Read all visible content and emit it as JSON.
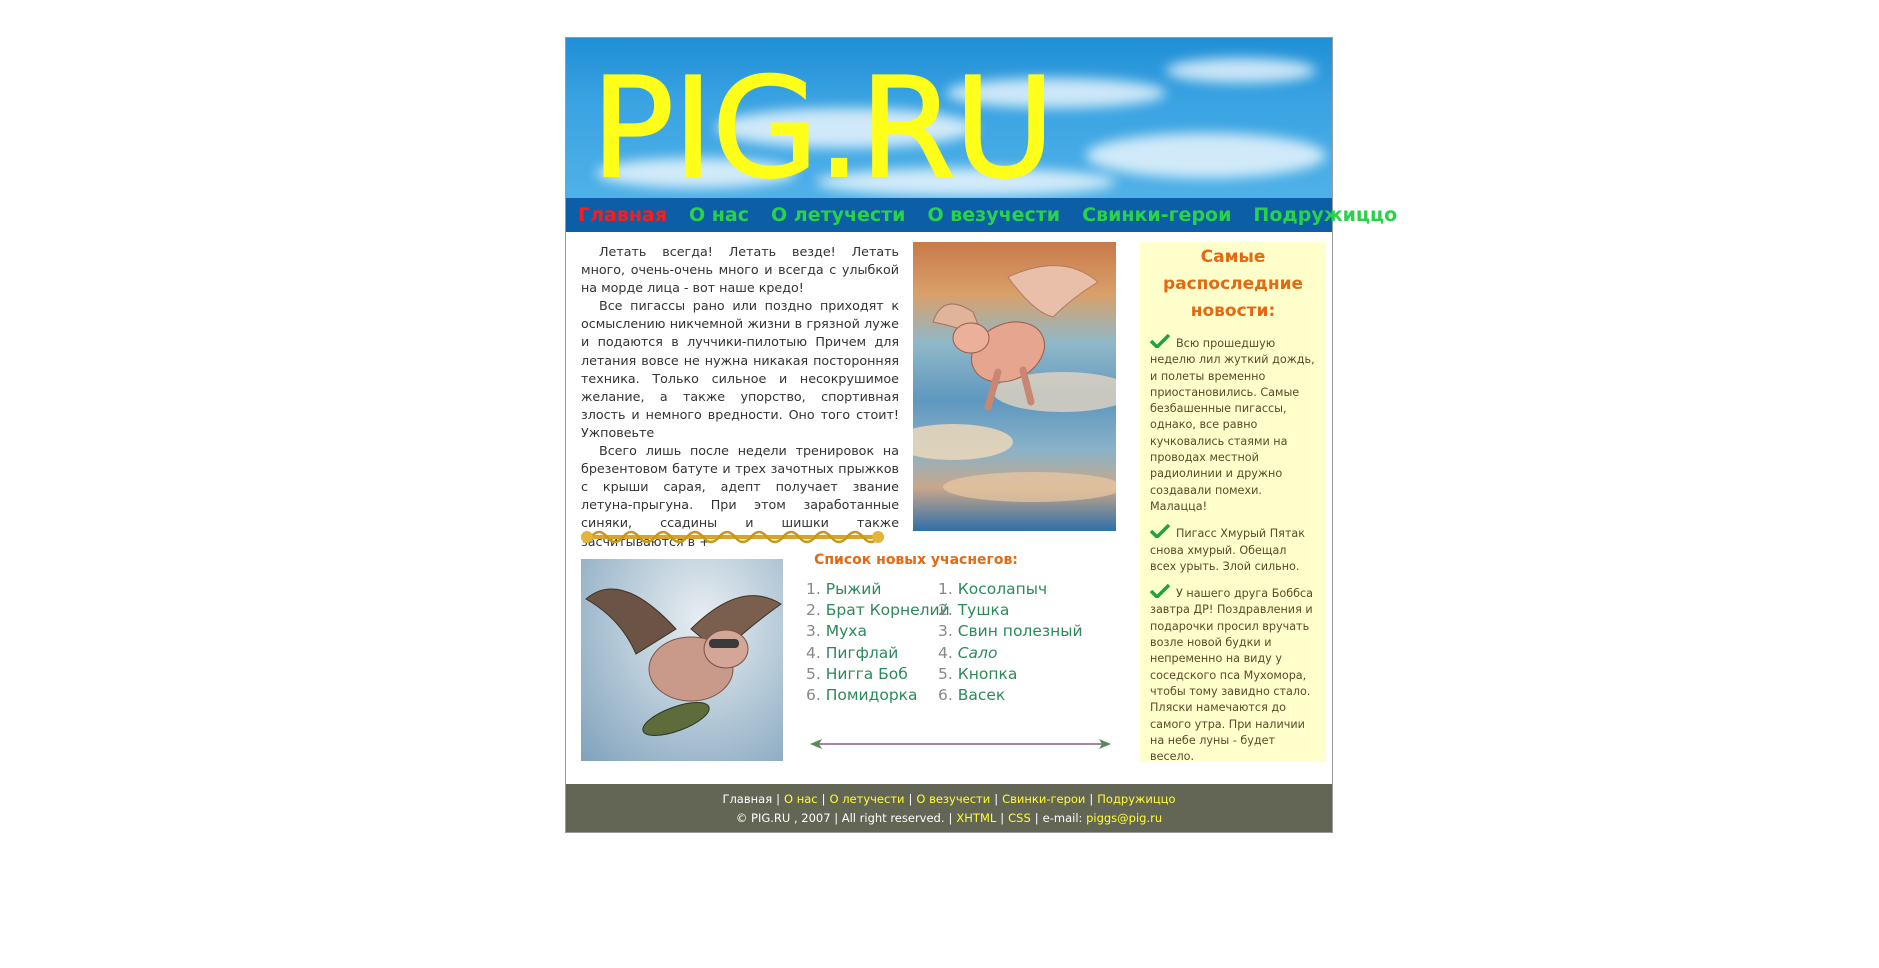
{
  "header": {
    "logo_text": "PIG.RU"
  },
  "nav": {
    "items": [
      {
        "label": "Главная",
        "active": true
      },
      {
        "label": "О нас",
        "active": false
      },
      {
        "label": "О летучести",
        "active": false
      },
      {
        "label": "О везучести",
        "active": false
      },
      {
        "label": "Свинки-герои",
        "active": false
      },
      {
        "label": "Подружиццо",
        "active": false
      }
    ]
  },
  "intro": {
    "paragraphs": [
      "Летать всегда! Летать везде! Летать много, очень-очень много и всегда с улыбкой на морде лица - вот наше кредо!",
      "Все пигассы рано или поздно приходят к осмыслению никчемной жизни в грязной луже и подаются в луччики-пилотыю Причем для летания вовсе не нужна никакая посторонняя техника. Только сильное и несокрушимое желание, а также упорство, спортивная злость и немного вредности. Оно того стоит! Ужповеьте",
      "Всего лишь после недели тренировок на брезентовом батуте и трех зачотных прыжков с крыши сарая, адепт получает звание летуна-прыгуна. При этом заработанные синяки, ссадины и шишки также засчитываются в +"
    ]
  },
  "members": {
    "title": "Список новых учаснегов:",
    "list1": [
      "Рыжий",
      "Брат Корнелий",
      "Муха",
      "Пигфлай",
      "Нигга Боб",
      "Помидорка"
    ],
    "list2": [
      "Косолапыч",
      "Тушка",
      "Свин полезный",
      "Сало",
      "Кнопка",
      "Васек"
    ]
  },
  "news": {
    "title": "Самые распоследние новости:",
    "items": [
      "Всю прошедшую неделю лил жуткий дождь, и полеты временно приостановились. Самые безбашенные пигассы, однако, все равно кучковались стаями на проводах местной радиолинии и дружно создавали помехи. Малацца!",
      "Пигасс Хмурый Пятак снова хмурый. Обещал всех урыть. Злой сильно.",
      "У нашего друга Боббса завтра ДР! Поздравления и подарочки просил вручать возле новой будки и непременно на виду у соседского пса Мухомора, чтобы тому завидно стало. Пляски намечаются до самого утра. При наличии на небе луны - будет весело."
    ]
  },
  "footer": {
    "links": [
      "Главная",
      "О нас",
      "О летучести",
      "О везучести",
      "Свинки-герои",
      "Подружиццо"
    ],
    "copyright": "© PIG.RU , 2007 | All right reserved.",
    "xhtml": "XHTML",
    "css": "CSS",
    "email_label": "e-mail:",
    "email": "piggs@pig.ru"
  },
  "colors": {
    "nav_bg": "#0c5fa6",
    "nav_link": "#2ad24a",
    "nav_active": "#ff1b1b",
    "accent_orange": "#e46a12",
    "news_bg": "#ffffcc",
    "footer_bg": "#636655",
    "footer_link": "#ffff33"
  }
}
